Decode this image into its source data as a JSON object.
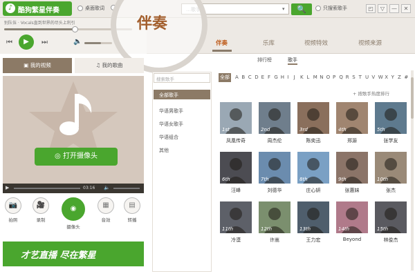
{
  "app": {
    "title": "酷狗繁星伴奏",
    "logo_glyph": "♪"
  },
  "titlebar": {
    "radio1_label": "桌面歌词",
    "radio2_label": "…",
    "search_placeholder": "…歌手",
    "search_button_glyph": "🔍",
    "only_singer_label": "只搜索歌手",
    "controls": [
      "◰",
      "▽",
      "—",
      "✕"
    ]
  },
  "player": {
    "song_info": "别队伍 · Vocals直到世界的尽头上利引",
    "progress": 0.55,
    "prev_glyph": "⏮",
    "play_glyph": "▶",
    "next_glyph": "⏭",
    "volume_glyph": "🔈",
    "volume": 0.6
  },
  "magnifier_label": "伴奏",
  "nav": {
    "tabs": [
      {
        "label": "伴奏",
        "active": true
      },
      {
        "label": "乐库",
        "active": false
      },
      {
        "label": "视频特效",
        "active": false
      },
      {
        "label": "视频来源",
        "active": false
      }
    ]
  },
  "left": {
    "my_video_tab": "我的视频",
    "my_song_tab": "我的歌曲",
    "camera_button": "打开摄像头",
    "video_time": "03:16",
    "tools": [
      {
        "label": "拍照",
        "icon": "📷"
      },
      {
        "label": "录制",
        "icon": "🎥"
      },
      {
        "label": "摄像头",
        "icon": "◉"
      },
      {
        "label": "音效",
        "icon": "▦"
      },
      {
        "label": "转播",
        "icon": "▤"
      }
    ],
    "banner": "才艺直播 尽在繁星"
  },
  "content": {
    "sub_tabs": [
      "排行榜",
      "歌手"
    ],
    "category_search_placeholder": "搜索歌手",
    "categories": [
      {
        "label": "全部歌手",
        "active": true
      },
      {
        "label": "华语男歌手",
        "active": false
      },
      {
        "label": "华语女歌手",
        "active": false
      },
      {
        "label": "华语组合",
        "active": false
      },
      {
        "label": "其他",
        "active": false
      }
    ],
    "alpha_all": "全部",
    "alphabet": [
      "A",
      "B",
      "C",
      "D",
      "E",
      "F",
      "G",
      "H",
      "I",
      "J",
      "K",
      "L",
      "M",
      "N",
      "O",
      "P",
      "Q",
      "R",
      "S",
      "T",
      "U",
      "V",
      "W",
      "X",
      "Y",
      "Z",
      "#"
    ],
    "hot_rank_label": "+ 按歌手热度排行",
    "artists": [
      {
        "name": "凤凰传奇",
        "rank": "1st",
        "color": "#9aa8b4"
      },
      {
        "name": "周杰伦",
        "rank": "2nd",
        "color": "#6f7e8c"
      },
      {
        "name": "陈奕迅",
        "rank": "3rd",
        "color": "#8a6f5c"
      },
      {
        "name": "郑源",
        "rank": "4th",
        "color": "#a08570"
      },
      {
        "name": "张学友",
        "rank": "5th",
        "color": "#5e7a8e"
      },
      {
        "name": "汪峰",
        "rank": "6th",
        "color": "#4c4c52"
      },
      {
        "name": "刘德华",
        "rank": "7th",
        "color": "#6b8cae"
      },
      {
        "name": "庄心妍",
        "rank": "8th",
        "color": "#7aa0c4"
      },
      {
        "name": "张惠妹",
        "rank": "9th",
        "color": "#8b7468"
      },
      {
        "name": "张杰",
        "rank": "10th",
        "color": "#9a8a78"
      },
      {
        "name": "冷漠",
        "rank": "11th",
        "color": "#5d6068"
      },
      {
        "name": "许嵩",
        "rank": "12th",
        "color": "#7b8f6e"
      },
      {
        "name": "王力宏",
        "rank": "13th",
        "color": "#4f5e6c"
      },
      {
        "name": "Beyond",
        "rank": "14th",
        "color": "#b07a8a"
      },
      {
        "name": "林俊杰",
        "rank": "15th",
        "color": "#5a5a60"
      }
    ]
  }
}
